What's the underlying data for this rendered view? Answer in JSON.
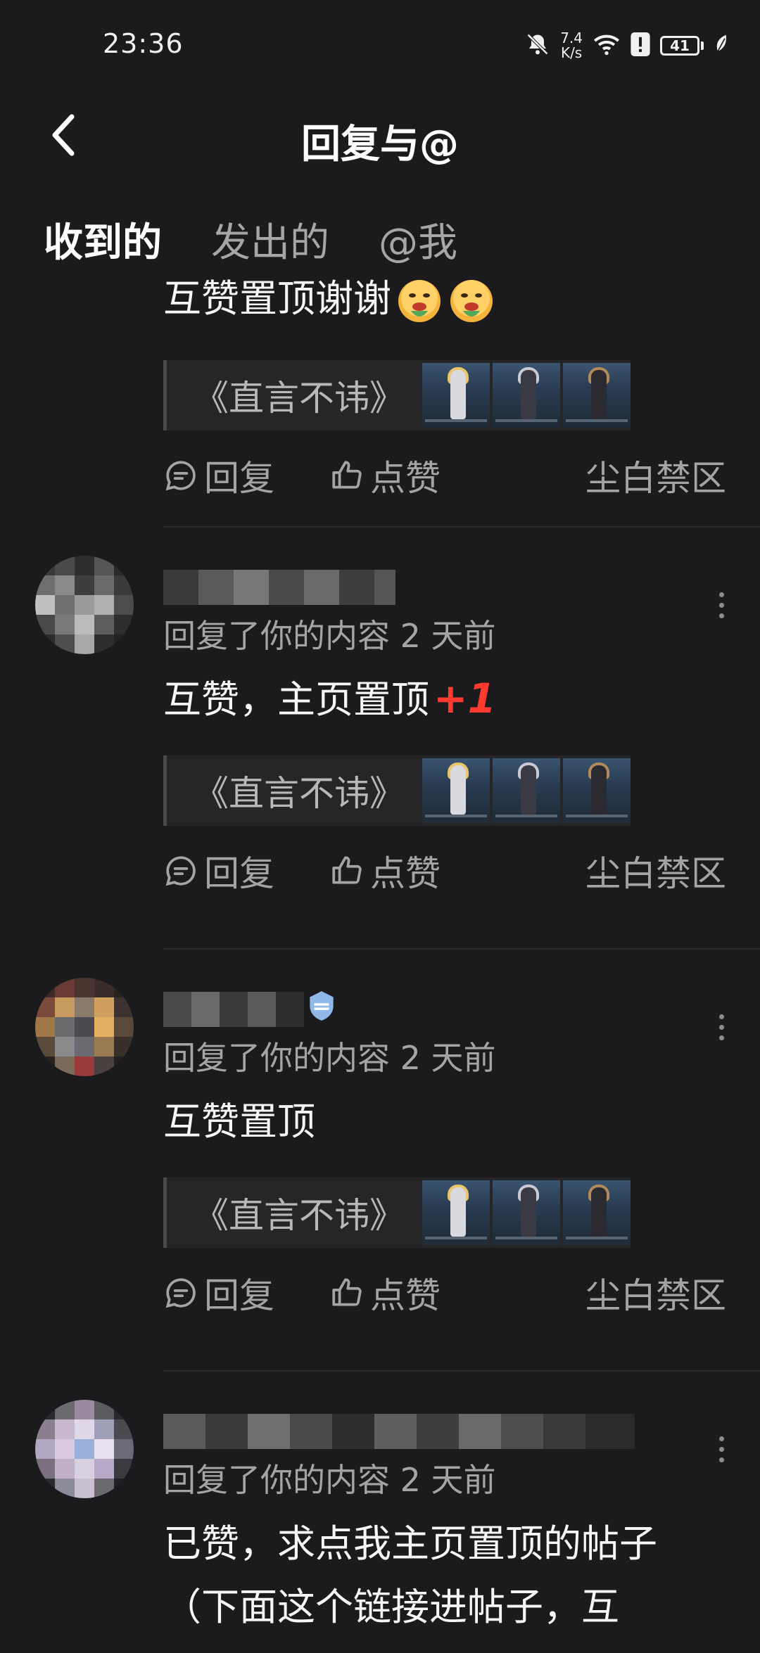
{
  "status_bar": {
    "time": "23:36",
    "net_speed_value": "7.4",
    "net_speed_unit": "K/s",
    "battery": "41"
  },
  "header": {
    "title": "回复与@"
  },
  "tabs": [
    {
      "label": "收到的",
      "active": true
    },
    {
      "label": "发出的",
      "active": false
    },
    {
      "label": "@我",
      "active": false
    }
  ],
  "feed": {
    "items": [
      {
        "reply_text": "互赞置顶谢谢",
        "quote_title": "《直言不讳》",
        "reply_label": "回复",
        "like_label": "点赞",
        "source": "尘白禁区"
      },
      {
        "meta": "回复了你的内容 2 天前",
        "reply_text": "互赞，主页置顶",
        "badge": "+1",
        "quote_title": "《直言不讳》",
        "reply_label": "回复",
        "like_label": "点赞",
        "source": "尘白禁区"
      },
      {
        "meta": "回复了你的内容 2 天前",
        "reply_text": "互赞置顶",
        "quote_title": "《直言不讳》",
        "reply_label": "回复",
        "like_label": "点赞",
        "source": "尘白禁区"
      },
      {
        "meta": "回复了你的内容 2 天前",
        "reply_text_line1": "已赞，求点我主页置顶的帖子",
        "reply_text_line2": "（下面这个链接进帖子，互"
      }
    ]
  },
  "colors": {
    "background": "#1b1b1d",
    "accent": "#2bb6a8",
    "secondary_text": "#a4a4a6",
    "badge_red": "#ff3b30"
  }
}
